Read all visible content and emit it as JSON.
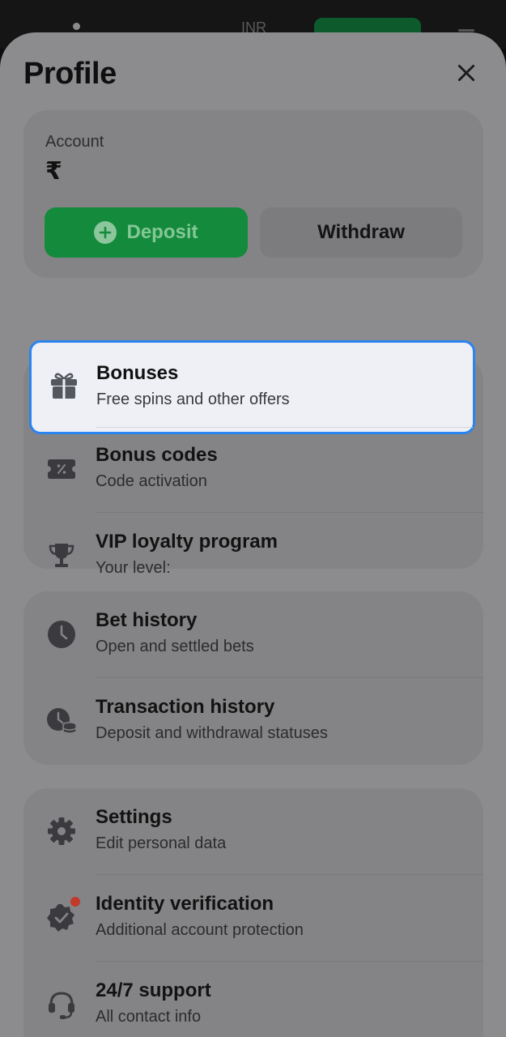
{
  "background_header": {
    "currency": "INR"
  },
  "sheet": {
    "title": "Profile"
  },
  "account": {
    "label": "Account",
    "balance": "₹",
    "deposit_label": "Deposit",
    "withdraw_label": "Withdraw"
  },
  "menu": {
    "bonuses": {
      "title": "Bonuses",
      "subtitle": "Free spins and other offers",
      "icon": "gift-icon"
    },
    "bonus_codes": {
      "title": "Bonus codes",
      "subtitle": "Code activation",
      "icon": "coupon-icon"
    },
    "vip": {
      "title": "VIP loyalty program",
      "subtitle": "Your level:",
      "icon": "trophy-icon"
    },
    "bet_history": {
      "title": "Bet history",
      "subtitle": "Open and settled bets",
      "icon": "clock-icon"
    },
    "transaction_history": {
      "title": "Transaction history",
      "subtitle": "Deposit and withdrawal statuses",
      "icon": "clock-coins-icon"
    },
    "settings": {
      "title": "Settings",
      "subtitle": "Edit personal data",
      "icon": "gear-icon"
    },
    "identity": {
      "title": "Identity verification",
      "subtitle": "Additional account protection",
      "icon": "verified-badge-icon"
    },
    "support": {
      "title": "24/7 support",
      "subtitle": "All contact info",
      "icon": "headset-icon"
    }
  },
  "colors": {
    "deposit_green": "#148a3c",
    "highlight_border": "#2a84f0",
    "notification_red": "#c0392b"
  }
}
